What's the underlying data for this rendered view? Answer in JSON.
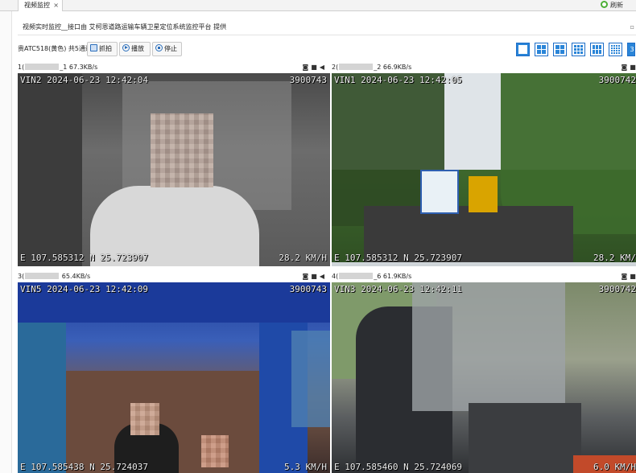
{
  "tabs": [
    {
      "label": "视频监控",
      "close_glyph": "×"
    }
  ],
  "refresh": {
    "label": "刷新",
    "icon": "refresh-icon",
    "color": "#4caf36"
  },
  "window": {
    "title": "视频实时监控__接口由 艾柯恩道路运输车辆卫星定位系统监控平台 提供",
    "maximize_glyph": "▫"
  },
  "toolbar": {
    "vehicle_info": "贵ATC518(黄色) 共5通道",
    "snapshot_label": "抓拍",
    "playback_label": "播放",
    "stop_label": "停止",
    "layout_buttons": [
      "1",
      "4",
      "6",
      "8",
      "9",
      "10",
      "16"
    ],
    "layout_last_label": "3",
    "active_layout": "1",
    "accent_color": "#2a85d8"
  },
  "channels": [
    {
      "index": "1",
      "head_prefix": "1(",
      "head_suffix": "_1 67.3KB/s",
      "osd_top": "VIN2 2024-06-23 12:42:04",
      "osd_id": "3900743",
      "osd_gps": "E 107.585312 N 25.723907",
      "osd_speed": "28.2 KM/H"
    },
    {
      "index": "2",
      "head_prefix": "2(",
      "head_suffix": "_2 66.9KB/s",
      "osd_top": "VIN1 2024-06-23 12:42:05",
      "osd_id": "3900742",
      "osd_gps": "E 107.585312 N 25.723907",
      "osd_speed": "28.2 KM/"
    },
    {
      "index": "3",
      "head_prefix": "3(",
      "head_suffix": " 65.4KB/s",
      "osd_top": "VIN5 2024-06-23 12:42:09",
      "osd_id": "3900743",
      "osd_gps": "E 107.585438 N 25.724037",
      "osd_speed": "5.3 KM/H"
    },
    {
      "index": "4",
      "head_prefix": "4(",
      "head_suffix": "_6 61.9KB/s",
      "osd_top": "VIN3 2024-06-23 12:42:11",
      "osd_id": "3900742",
      "osd_gps": "E 107.585460 N 25.724069",
      "osd_speed": "6.0 KM/H"
    }
  ],
  "channel_icons": [
    "camera-icon",
    "record-icon",
    "audio-icon"
  ]
}
